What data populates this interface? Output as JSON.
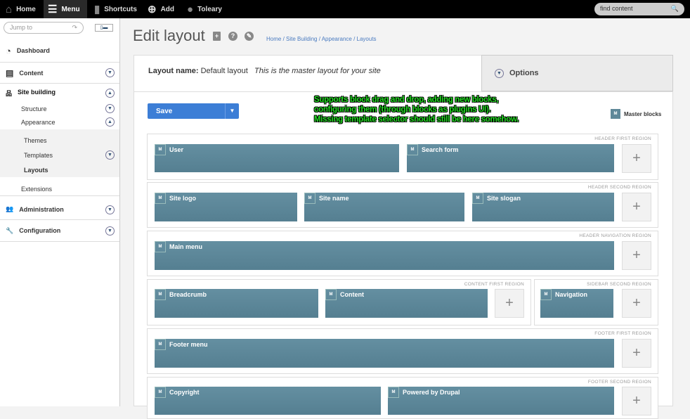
{
  "toolbar": {
    "home": "Home",
    "menu": "Menu",
    "shortcuts": "Shortcuts",
    "add": "Add",
    "user": "Toleary",
    "search_placeholder": "find content"
  },
  "sidebar": {
    "jump_placeholder": "Jump to",
    "dashboard": "Dashboard",
    "content": "Content",
    "site_building": "Site building",
    "structure": "Structure",
    "appearance": "Appearance",
    "themes": "Themes",
    "templates": "Templates",
    "layouts": "Layouts",
    "extensions": "Extensions",
    "administration": "Administration",
    "configuration": "Configuration"
  },
  "page": {
    "title": "Edit layout",
    "breadcrumb": "Home / Site Building / Appearance  / Layouts",
    "layout_name_label": "Layout name:",
    "layout_name": "Default layout",
    "layout_desc": "This is the master layout for your site",
    "options": "Options",
    "save": "Save",
    "master_blocks": "Master blocks",
    "block_badge": "M",
    "note": [
      "Supports block drag and drop, adding new blocks,",
      "configuring them (through blocks as plugins UI).",
      "Missing template selector should still be here somehow."
    ]
  },
  "regions": [
    {
      "label": "HEADER  FIRST REGION",
      "blocks": [
        "User",
        "Search form"
      ]
    },
    {
      "label": "HEADER SECOND REGION",
      "blocks": [
        "Site logo",
        "Site name",
        "Site slogan"
      ]
    },
    {
      "label": "HEADER NAVIGATION REGION",
      "blocks": [
        "Main menu"
      ]
    },
    {
      "label": "CONTENT FIRST REGION",
      "blocks": [
        "Breadcrumb",
        "Content"
      ]
    },
    {
      "label": "SIDEBAR SECOND REGION",
      "blocks": [
        "Navigation"
      ]
    },
    {
      "label": "FOOTER FIRST REGION",
      "blocks": [
        "Footer menu"
      ]
    },
    {
      "label": "FOOTER SECOND REGION",
      "blocks": [
        "Copyright",
        "Powered by Drupal"
      ]
    }
  ]
}
